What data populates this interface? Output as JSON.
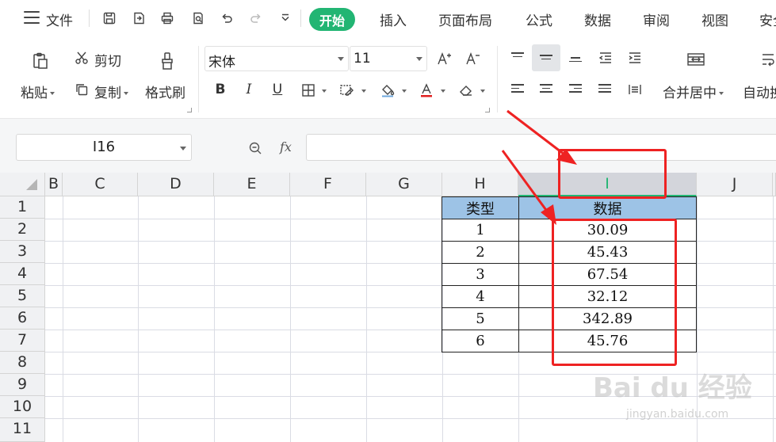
{
  "menu": {
    "file": "文件",
    "tabs": [
      "开始",
      "插入",
      "页面布局",
      "公式",
      "数据",
      "审阅",
      "视图",
      "安全"
    ]
  },
  "ribbon": {
    "paste": "粘贴",
    "cut": "剪切",
    "copy": "复制",
    "format_painter": "格式刷",
    "font_name": "宋体",
    "font_size": "11",
    "bold": "B",
    "italic": "I",
    "underline": "U",
    "merge_center": "合并居中",
    "auto_wrap": "自动换行"
  },
  "formula_bar": {
    "cell_ref": "I16",
    "fx": "fx",
    "value": ""
  },
  "grid": {
    "columns": [
      "B",
      "C",
      "D",
      "E",
      "F",
      "G",
      "H",
      "I",
      "J"
    ],
    "selected_column": "I",
    "rows": [
      "1",
      "2",
      "3",
      "4",
      "5",
      "6",
      "7",
      "8",
      "9",
      "10",
      "11"
    ]
  },
  "table": {
    "headers": [
      "类型",
      "数据"
    ],
    "rows": [
      [
        "1",
        "30.09"
      ],
      [
        "2",
        "45.43"
      ],
      [
        "3",
        "67.54"
      ],
      [
        "4",
        "32.12"
      ],
      [
        "5",
        "342.89"
      ],
      [
        "6",
        "45.76"
      ]
    ],
    "header_color": "#9dc3e6"
  },
  "colors": {
    "accent": "#22b573",
    "annotation": "#ee2222"
  },
  "watermark": {
    "main": "Bai du 经验",
    "sub": "jingyan.baidu.com"
  }
}
